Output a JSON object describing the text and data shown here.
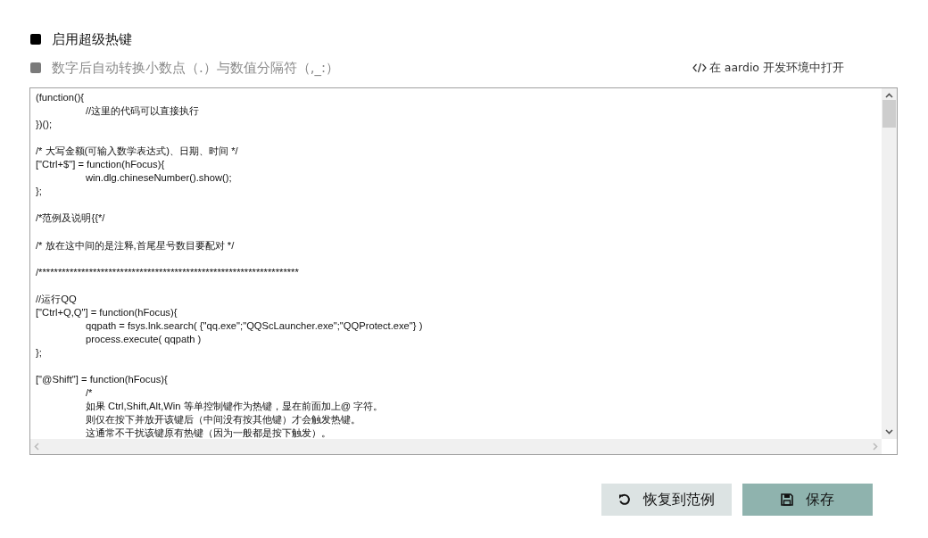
{
  "options": [
    {
      "label": "启用超级热键",
      "checked": true
    },
    {
      "label": "数字后自动转换小数点（.）与数值分隔符（,_:）",
      "checked": false
    }
  ],
  "open_link": {
    "label": "在 aardio 开发环境中打开"
  },
  "editor": {
    "blocks": [
      [
        {
          "text": "(function(){",
          "children": [
            {
              "text": "//这里的代码可以直接执行"
            }
          ]
        },
        {
          "text": "})();"
        }
      ],
      [
        {
          "text": "/* 大写金额(可输入数学表达式)、日期、时间  */"
        },
        {
          "text": "[\"Ctrl+$\"] = function(hFocus){",
          "children": [
            {
              "text": "win.dlg.chineseNumber().show();"
            }
          ]
        },
        {
          "text": "};"
        }
      ],
      [
        {
          "text": "/*范例及说明{{*/"
        }
      ],
      [
        {
          "text": "/* 放在这中间的是注释,首尾星号数目要配对 */"
        }
      ],
      [
        {
          "text": "/*******************************************************************"
        }
      ],
      [
        {
          "text": "//运行QQ"
        },
        {
          "text": "[\"Ctrl+Q,Q\"] = function(hFocus){",
          "children": [
            {
              "text": "qqpath = fsys.lnk.search( {\"qq.exe\";\"QQScLauncher.exe\";\"QQProtect.exe\"} )"
            },
            {
              "text": "process.execute( qqpath )"
            }
          ]
        },
        {
          "text": "};"
        }
      ],
      [
        {
          "text": "[\"@Shift\"] = function(hFocus){",
          "children": [
            {
              "text": "/*"
            },
            {
              "text": "如果 Ctrl,Shift,Alt,Win 等单控制键作为热键，显在前面加上@ 字符。"
            },
            {
              "text": "则仅在按下并放开该键后（中间没有按其他键）才会触发热键。"
            },
            {
              "text": "这通常不干扰该键原有热键（因为一般都是按下触发）。"
            }
          ]
        }
      ]
    ]
  },
  "buttons": [
    {
      "label": "恢复到范例",
      "kind": "restore"
    },
    {
      "label": "保存",
      "kind": "save"
    }
  ]
}
